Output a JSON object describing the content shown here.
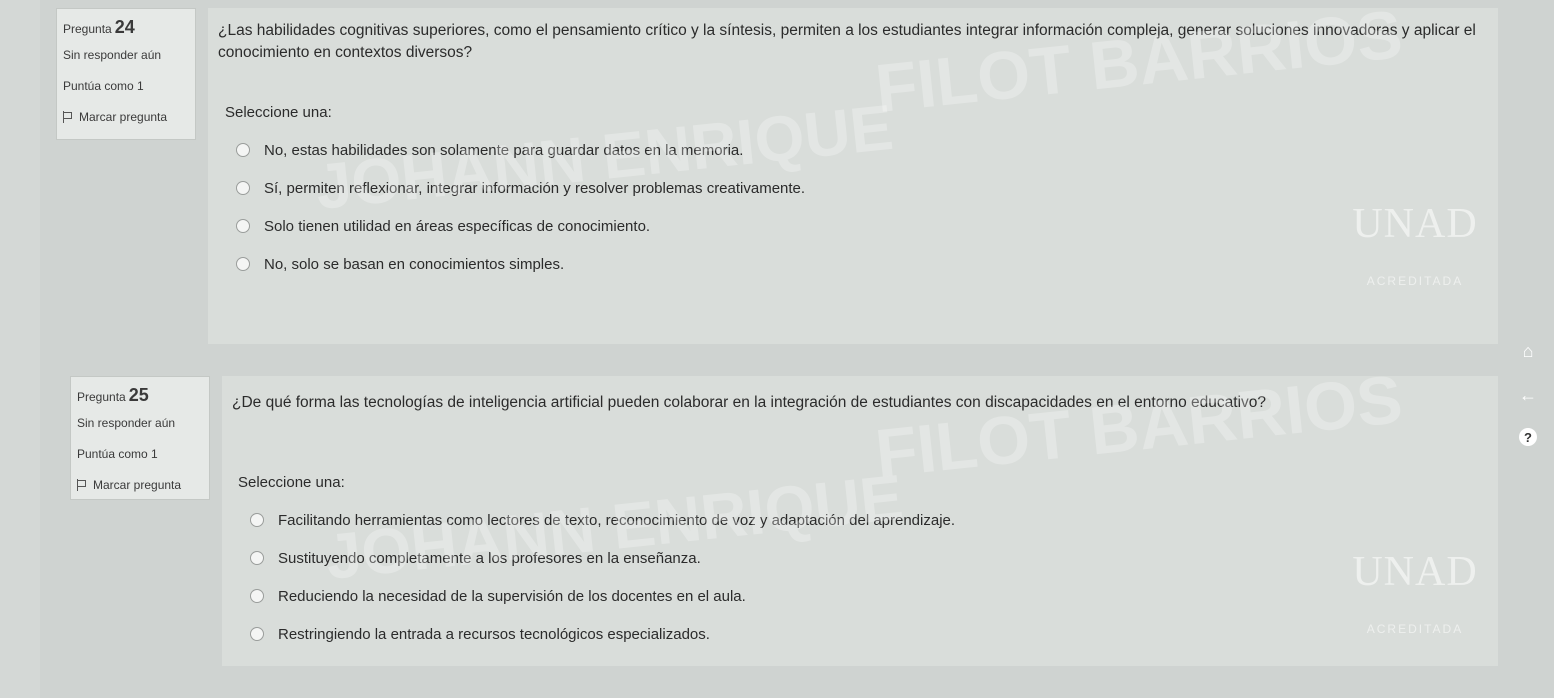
{
  "questions": [
    {
      "label": "Pregunta",
      "number": "24",
      "status": "Sin responder aún",
      "score": "Puntúa como 1",
      "flag": "Marcar pregunta",
      "text": "¿Las habilidades cognitivas superiores, como el pensamiento crítico y la síntesis, permiten a los estudiantes integrar información compleja, generar soluciones innovadoras y aplicar el conocimiento en contextos diversos?",
      "prompt": "Seleccione una:",
      "options": [
        "No, estas habilidades son solamente para guardar datos en la memoria.",
        "Sí, permiten reflexionar, integrar información y resolver problemas creativamente.",
        "Solo tienen utilidad en áreas específicas de conocimiento.",
        "No, solo se basan en conocimientos simples."
      ]
    },
    {
      "label": "Pregunta",
      "number": "25",
      "status": "Sin responder aún",
      "score": "Puntúa como 1",
      "flag": "Marcar pregunta",
      "text": "¿De qué forma las tecnologías de inteligencia artificial pueden colaborar en la integración de estudiantes con discapacidades en el entorno educativo?",
      "prompt": "Seleccione una:",
      "options": [
        "Facilitando herramientas como lectores de texto, reconocimiento de voz y adaptación del aprendizaje.",
        "Sustituyendo completamente a los profesores en la enseñanza.",
        "Reduciendo la necesidad de la supervisión de los docentes en el aula.",
        "Restringiendo la entrada a recursos tecnológicos especializados."
      ]
    }
  ],
  "watermark": {
    "line1": "FILOT BARRIOS",
    "line2": "JOHANN ENRIQUE",
    "logo": "UNAD",
    "badge": "ACREDITADA"
  },
  "side_icons": [
    "home-icon",
    "back-arrow-icon",
    "help-icon"
  ]
}
